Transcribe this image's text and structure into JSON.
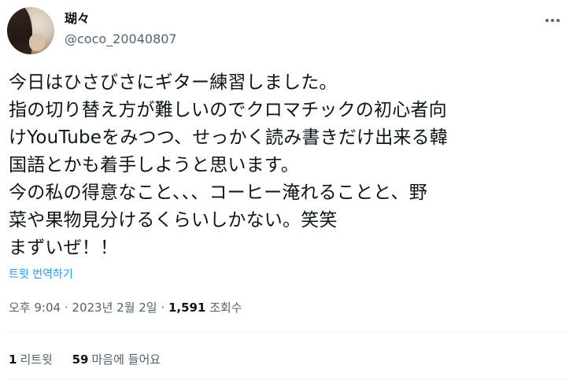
{
  "author": {
    "display_name": "瑚々",
    "handle": "@coco_20040807"
  },
  "tweet": {
    "lines": [
      "今日はひさびさにギター練習しました。",
      "指の切り替え方が難しいのでクロマチックの初心者向",
      "けYouTubeをみつつ、せっかく読み書きだけ出来る韓",
      "国語とかも着手しようと思います。",
      "今の私の得意なこと、、、コーヒー淹れることと、野",
      "菜や果物見分けるくらいしかない。笑笑",
      "まずいぜ！！"
    ],
    "translate_label": "트윗 번역하기"
  },
  "meta": {
    "time": "오후 9:04",
    "separator": "·",
    "date": "2023년 2월 2일",
    "views_count": "1,591",
    "views_label": "조회수"
  },
  "stats": {
    "retweets_count": "1",
    "retweets_label": "리트윗",
    "likes_count": "59",
    "likes_label": "마음에 들어요"
  },
  "icons": {
    "more": "more-horizontal-icon"
  }
}
